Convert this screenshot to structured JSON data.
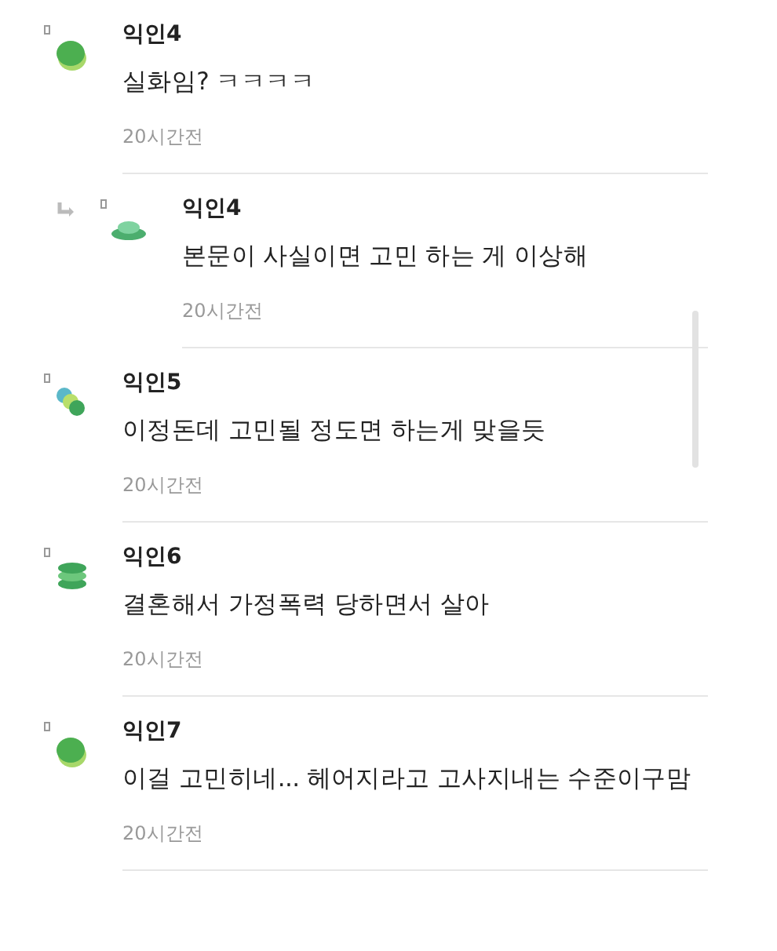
{
  "comments": [
    {
      "kind": "blob",
      "reply": false,
      "author": "익인4",
      "body": "실화임? ㅋㅋㅋㅋ",
      "time": "20시간전"
    },
    {
      "kind": "mound",
      "reply": true,
      "author": "익인4",
      "body": "본문이 사실이면 고민 하는 게 이상해",
      "time": "20시간전"
    },
    {
      "kind": "dots",
      "reply": false,
      "author": "익인5",
      "body": "이정돈데 고민될 정도면 하는게 맞을듯",
      "time": "20시간전"
    },
    {
      "kind": "stack",
      "reply": false,
      "author": "익인6",
      "body": "결혼해서 가정폭력 당하면서 살아",
      "time": "20시간전"
    },
    {
      "kind": "blob",
      "reply": false,
      "author": "익인7",
      "body": "이걸 고민히네... 헤어지라고 고사지내는 수준이구맘",
      "time": "20시간전"
    }
  ]
}
